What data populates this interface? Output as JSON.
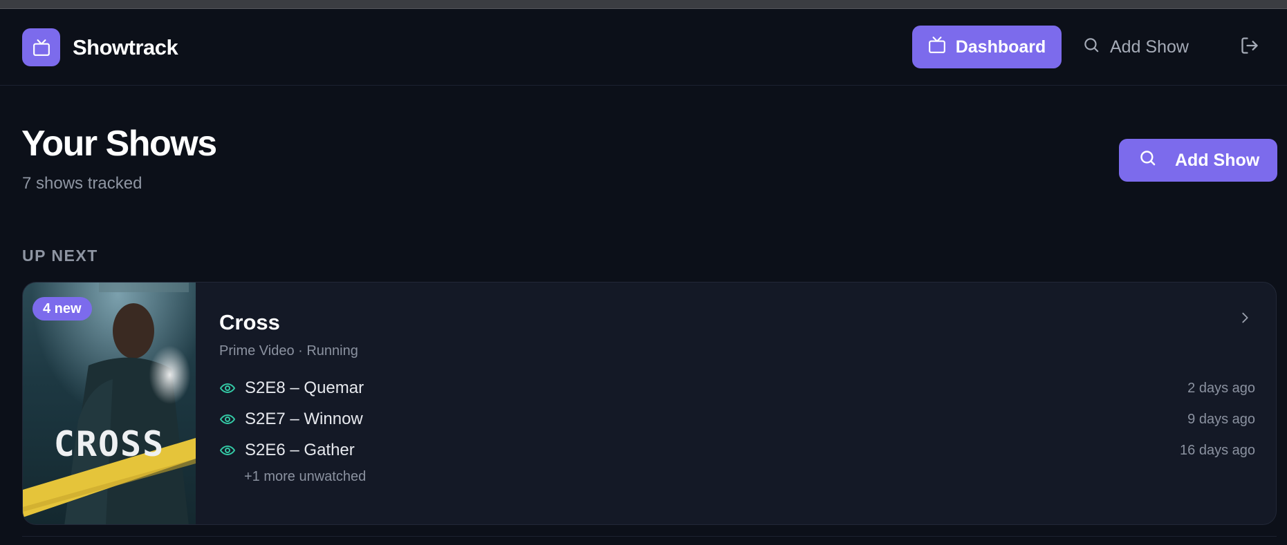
{
  "app": {
    "name": "Showtrack",
    "logo_icon": "tv-icon",
    "accent_color": "#7c6bec"
  },
  "nav": {
    "dashboard_label": "Dashboard",
    "add_show_label": "Add Show",
    "logout_icon": "logout-icon"
  },
  "page": {
    "title": "Your Shows",
    "subtitle": "7 shows tracked",
    "add_show_button": "Add Show"
  },
  "up_next": {
    "label": "UP NEXT",
    "card": {
      "badge": "4 new",
      "poster_title": "CROSS",
      "title": "Cross",
      "meta": "Prime Video · Running",
      "episodes": [
        {
          "label": "S2E8 – Quemar",
          "date": "2 days ago"
        },
        {
          "label": "S2E7 – Winnow",
          "date": "9 days ago"
        },
        {
          "label": "S2E6 – Gather",
          "date": "16 days ago"
        }
      ],
      "more": "+1 more unwatched",
      "watch_icon_color": "#34c9a5"
    }
  }
}
